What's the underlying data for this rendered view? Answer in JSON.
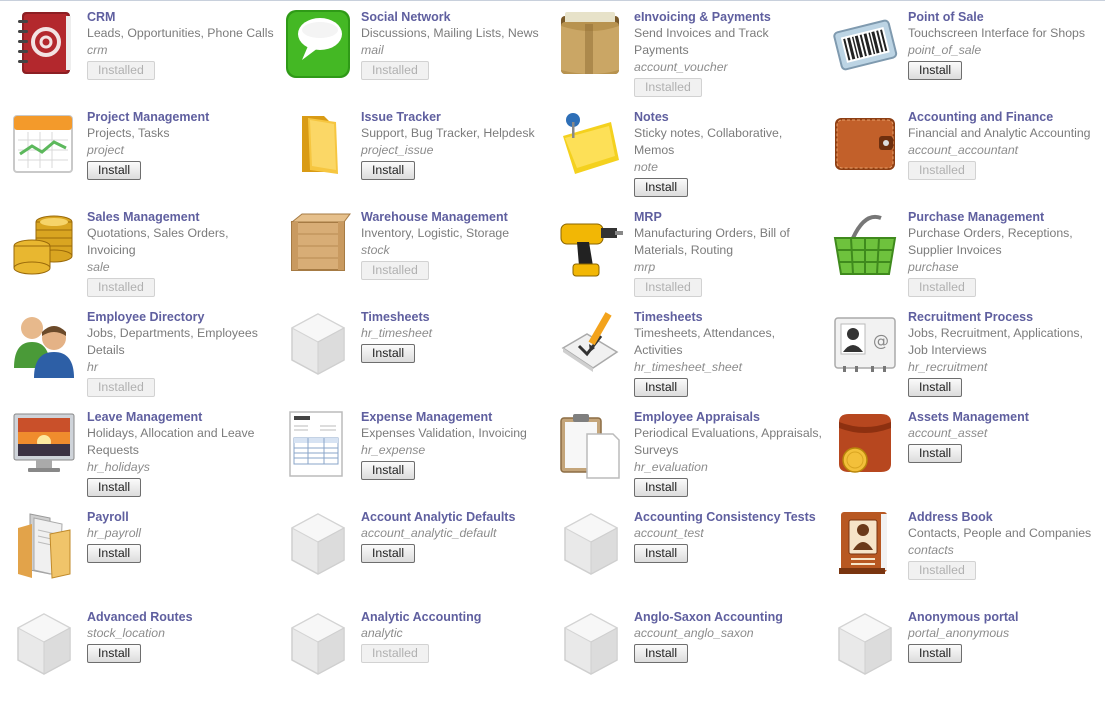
{
  "modules": [
    {
      "title": "CRM",
      "summary": "Leads, Opportunities, Phone Calls",
      "tech": "crm",
      "button": "Installed",
      "installed": true,
      "icon": "crm-address-book-icon"
    },
    {
      "title": "Social Network",
      "summary": "Discussions, Mailing Lists, News",
      "tech": "mail",
      "button": "Installed",
      "installed": true,
      "icon": "speech-bubble-icon"
    },
    {
      "title": "eInvoicing & Payments",
      "summary": "Send Invoices and Track Payments",
      "tech": "account_voucher",
      "button": "Installed",
      "installed": true,
      "icon": "wallet-icon"
    },
    {
      "title": "Point of Sale",
      "summary": "Touchscreen Interface for Shops",
      "tech": "point_of_sale",
      "button": "Install",
      "installed": false,
      "icon": "barcode-scanner-icon"
    },
    {
      "title": "Project Management",
      "summary": "Projects, Tasks",
      "tech": "project",
      "button": "Install",
      "installed": false,
      "icon": "calendar-icon"
    },
    {
      "title": "Issue Tracker",
      "summary": "Support, Bug Tracker, Helpdesk",
      "tech": "project_issue",
      "button": "Install",
      "installed": false,
      "icon": "folder-icon"
    },
    {
      "title": "Notes",
      "summary": "Sticky notes, Collaborative, Memos",
      "tech": "note",
      "button": "Install",
      "installed": false,
      "icon": "sticky-note-icon"
    },
    {
      "title": "Accounting and Finance",
      "summary": "Financial and Analytic Accounting",
      "tech": "account_accountant",
      "button": "Installed",
      "installed": true,
      "icon": "leather-wallet-icon"
    },
    {
      "title": "Sales Management",
      "summary": "Quotations, Sales Orders, Invoicing",
      "tech": "sale",
      "button": "Installed",
      "installed": true,
      "icon": "gold-coins-icon"
    },
    {
      "title": "Warehouse Management",
      "summary": "Inventory, Logistic, Storage",
      "tech": "stock",
      "button": "Installed",
      "installed": true,
      "icon": "wooden-crate-icon"
    },
    {
      "title": "MRP",
      "summary": "Manufacturing Orders, Bill of Materials, Routing",
      "tech": "mrp",
      "button": "Installed",
      "installed": true,
      "icon": "power-drill-icon"
    },
    {
      "title": "Purchase Management",
      "summary": "Purchase Orders, Receptions, Supplier Invoices",
      "tech": "purchase",
      "button": "Installed",
      "installed": true,
      "icon": "shopping-basket-icon"
    },
    {
      "title": "Employee Directory",
      "summary": "Jobs, Departments, Employees Details",
      "tech": "hr",
      "button": "Installed",
      "installed": true,
      "icon": "employees-icon"
    },
    {
      "title": "Timesheets",
      "summary": "",
      "tech": "hr_timesheet",
      "button": "Install",
      "installed": false,
      "icon": "module-cube-icon"
    },
    {
      "title": "Timesheets",
      "summary": "Timesheets, Attendances, Activities",
      "tech": "hr_timesheet_sheet",
      "button": "Install",
      "installed": false,
      "icon": "pencil-checkbox-icon"
    },
    {
      "title": "Recruitment Process",
      "summary": "Jobs, Recruitment, Applications, Job Interviews",
      "tech": "hr_recruitment",
      "button": "Install",
      "installed": false,
      "icon": "contact-card-icon"
    },
    {
      "title": "Leave Management",
      "summary": "Holidays, Allocation and Leave Requests",
      "tech": "hr_holidays",
      "button": "Install",
      "installed": false,
      "icon": "sunset-monitor-icon"
    },
    {
      "title": "Expense Management",
      "summary": "Expenses Validation, Invoicing",
      "tech": "hr_expense",
      "button": "Install",
      "installed": false,
      "icon": "invoice-document-icon"
    },
    {
      "title": "Employee Appraisals",
      "summary": "Periodical Evaluations, Appraisals, Surveys",
      "tech": "hr_evaluation",
      "button": "Install",
      "installed": false,
      "icon": "clipboard-icon"
    },
    {
      "title": "Assets Management",
      "summary": "",
      "tech": "account_asset",
      "button": "Install",
      "installed": false,
      "icon": "coin-purse-icon"
    },
    {
      "title": "Payroll",
      "summary": "",
      "tech": "hr_payroll",
      "button": "Install",
      "installed": false,
      "icon": "document-folder-icon"
    },
    {
      "title": "Account Analytic Defaults",
      "summary": "",
      "tech": "account_analytic_default",
      "button": "Install",
      "installed": false,
      "icon": "module-cube-icon"
    },
    {
      "title": "Accounting Consistency Tests",
      "summary": "",
      "tech": "account_test",
      "button": "Install",
      "installed": false,
      "icon": "module-cube-icon"
    },
    {
      "title": "Address Book",
      "summary": "Contacts, People and Companies",
      "tech": "contacts",
      "button": "Installed",
      "installed": true,
      "icon": "address-book-icon"
    },
    {
      "title": "Advanced Routes",
      "summary": "",
      "tech": "stock_location",
      "button": "Install",
      "installed": false,
      "icon": "module-cube-icon"
    },
    {
      "title": "Analytic Accounting",
      "summary": "",
      "tech": "analytic",
      "button": "Installed",
      "installed": true,
      "icon": "module-cube-icon"
    },
    {
      "title": "Anglo-Saxon Accounting",
      "summary": "",
      "tech": "account_anglo_saxon",
      "button": "Install",
      "installed": false,
      "icon": "module-cube-icon"
    },
    {
      "title": "Anonymous portal",
      "summary": "",
      "tech": "portal_anonymous",
      "button": "Install",
      "installed": false,
      "icon": "module-cube-icon"
    }
  ]
}
